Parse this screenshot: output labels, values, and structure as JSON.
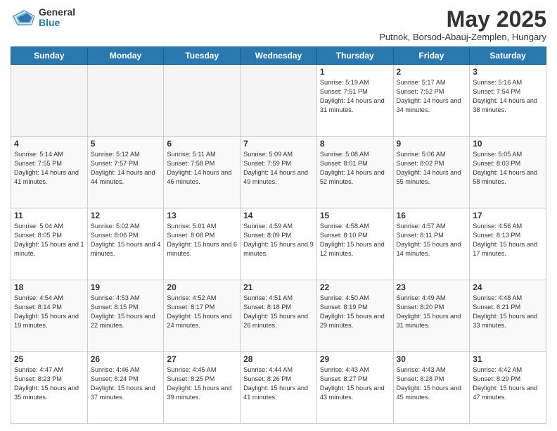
{
  "logo": {
    "general": "General",
    "blue": "Blue"
  },
  "title": {
    "month_year": "May 2025",
    "location": "Putnok, Borsod-Abauj-Zemplen, Hungary"
  },
  "days_of_week": [
    "Sunday",
    "Monday",
    "Tuesday",
    "Wednesday",
    "Thursday",
    "Friday",
    "Saturday"
  ],
  "weeks": [
    [
      {
        "date": "",
        "info": ""
      },
      {
        "date": "",
        "info": ""
      },
      {
        "date": "",
        "info": ""
      },
      {
        "date": "",
        "info": ""
      },
      {
        "date": "1",
        "info": "Sunrise: 5:19 AM\nSunset: 7:51 PM\nDaylight: 14 hours and 31 minutes."
      },
      {
        "date": "2",
        "info": "Sunrise: 5:17 AM\nSunset: 7:52 PM\nDaylight: 14 hours and 34 minutes."
      },
      {
        "date": "3",
        "info": "Sunrise: 5:16 AM\nSunset: 7:54 PM\nDaylight: 14 hours and 38 minutes."
      }
    ],
    [
      {
        "date": "4",
        "info": "Sunrise: 5:14 AM\nSunset: 7:55 PM\nDaylight: 14 hours and 41 minutes."
      },
      {
        "date": "5",
        "info": "Sunrise: 5:12 AM\nSunset: 7:57 PM\nDaylight: 14 hours and 44 minutes."
      },
      {
        "date": "6",
        "info": "Sunrise: 5:11 AM\nSunset: 7:58 PM\nDaylight: 14 hours and 46 minutes."
      },
      {
        "date": "7",
        "info": "Sunrise: 5:09 AM\nSunset: 7:59 PM\nDaylight: 14 hours and 49 minutes."
      },
      {
        "date": "8",
        "info": "Sunrise: 5:08 AM\nSunset: 8:01 PM\nDaylight: 14 hours and 52 minutes."
      },
      {
        "date": "9",
        "info": "Sunrise: 5:06 AM\nSunset: 8:02 PM\nDaylight: 14 hours and 55 minutes."
      },
      {
        "date": "10",
        "info": "Sunrise: 5:05 AM\nSunset: 8:03 PM\nDaylight: 14 hours and 58 minutes."
      }
    ],
    [
      {
        "date": "11",
        "info": "Sunrise: 5:04 AM\nSunset: 8:05 PM\nDaylight: 15 hours and 1 minute."
      },
      {
        "date": "12",
        "info": "Sunrise: 5:02 AM\nSunset: 8:06 PM\nDaylight: 15 hours and 4 minutes."
      },
      {
        "date": "13",
        "info": "Sunrise: 5:01 AM\nSunset: 8:08 PM\nDaylight: 15 hours and 6 minutes."
      },
      {
        "date": "14",
        "info": "Sunrise: 4:59 AM\nSunset: 8:09 PM\nDaylight: 15 hours and 9 minutes."
      },
      {
        "date": "15",
        "info": "Sunrise: 4:58 AM\nSunset: 8:10 PM\nDaylight: 15 hours and 12 minutes."
      },
      {
        "date": "16",
        "info": "Sunrise: 4:57 AM\nSunset: 8:11 PM\nDaylight: 15 hours and 14 minutes."
      },
      {
        "date": "17",
        "info": "Sunrise: 4:56 AM\nSunset: 8:13 PM\nDaylight: 15 hours and 17 minutes."
      }
    ],
    [
      {
        "date": "18",
        "info": "Sunrise: 4:54 AM\nSunset: 8:14 PM\nDaylight: 15 hours and 19 minutes."
      },
      {
        "date": "19",
        "info": "Sunrise: 4:53 AM\nSunset: 8:15 PM\nDaylight: 15 hours and 22 minutes."
      },
      {
        "date": "20",
        "info": "Sunrise: 4:52 AM\nSunset: 8:17 PM\nDaylight: 15 hours and 24 minutes."
      },
      {
        "date": "21",
        "info": "Sunrise: 4:51 AM\nSunset: 8:18 PM\nDaylight: 15 hours and 26 minutes."
      },
      {
        "date": "22",
        "info": "Sunrise: 4:50 AM\nSunset: 8:19 PM\nDaylight: 15 hours and 29 minutes."
      },
      {
        "date": "23",
        "info": "Sunrise: 4:49 AM\nSunset: 8:20 PM\nDaylight: 15 hours and 31 minutes."
      },
      {
        "date": "24",
        "info": "Sunrise: 4:48 AM\nSunset: 8:21 PM\nDaylight: 15 hours and 33 minutes."
      }
    ],
    [
      {
        "date": "25",
        "info": "Sunrise: 4:47 AM\nSunset: 8:23 PM\nDaylight: 15 hours and 35 minutes."
      },
      {
        "date": "26",
        "info": "Sunrise: 4:46 AM\nSunset: 8:24 PM\nDaylight: 15 hours and 37 minutes."
      },
      {
        "date": "27",
        "info": "Sunrise: 4:45 AM\nSunset: 8:25 PM\nDaylight: 15 hours and 39 minutes."
      },
      {
        "date": "28",
        "info": "Sunrise: 4:44 AM\nSunset: 8:26 PM\nDaylight: 15 hours and 41 minutes."
      },
      {
        "date": "29",
        "info": "Sunrise: 4:43 AM\nSunset: 8:27 PM\nDaylight: 15 hours and 43 minutes."
      },
      {
        "date": "30",
        "info": "Sunrise: 4:43 AM\nSunset: 8:28 PM\nDaylight: 15 hours and 45 minutes."
      },
      {
        "date": "31",
        "info": "Sunrise: 4:42 AM\nSunset: 8:29 PM\nDaylight: 15 hours and 47 minutes."
      }
    ]
  ]
}
